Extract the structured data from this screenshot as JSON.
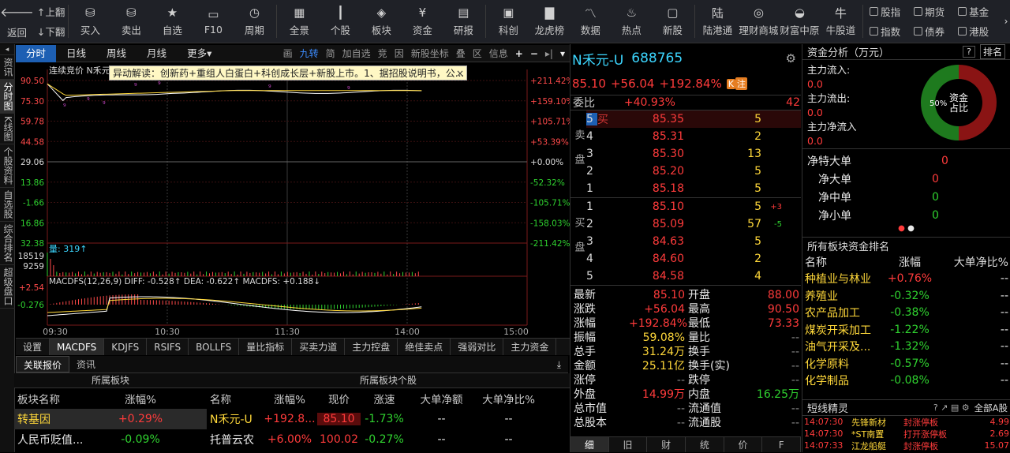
{
  "toolbar": {
    "back": "返回",
    "up": "上翻",
    "down": "下翻",
    "items": [
      {
        "label": "买入",
        "icon": "buy-icon"
      },
      {
        "label": "卖出",
        "icon": "sell-icon"
      },
      {
        "label": "自选",
        "icon": "star-icon"
      },
      {
        "label": "F10",
        "icon": "f10-icon"
      },
      {
        "label": "周期",
        "icon": "clock-icon"
      },
      {
        "label": "全景",
        "icon": "grid-icon"
      },
      {
        "label": "个股",
        "icon": "candle-icon"
      },
      {
        "label": "板块",
        "icon": "layers-icon"
      },
      {
        "label": "资金",
        "icon": "yen-icon"
      },
      {
        "label": "研报",
        "icon": "report-icon"
      },
      {
        "label": "科创",
        "icon": "chip-icon"
      },
      {
        "label": "龙虎榜",
        "icon": "bars-icon"
      },
      {
        "label": "数据",
        "icon": "linechart-icon"
      },
      {
        "label": "热点",
        "icon": "flame-icon"
      },
      {
        "label": "新股",
        "icon": "ipo-icon"
      },
      {
        "label": "陆港通",
        "icon": "lu-icon"
      },
      {
        "label": "理财商城",
        "icon": "target-icon"
      },
      {
        "label": "财富中原",
        "icon": "ingot-icon"
      },
      {
        "label": "牛股道",
        "icon": "bull-icon"
      }
    ],
    "exch": [
      "股指",
      "期货",
      "基金",
      "指数",
      "债券",
      "港股"
    ]
  },
  "leftbar": [
    "资讯",
    "分时图",
    "K线图",
    "个股资料",
    "自选股",
    "综合排名",
    "超级盘口"
  ],
  "period": {
    "tabs": [
      "分时",
      "日线",
      "周线",
      "月线",
      "更多▾"
    ],
    "tools": [
      "画",
      "九转",
      "简",
      "加自选",
      "竞",
      "因",
      "新股坐标",
      "叠",
      "区",
      "信息",
      "+",
      "−",
      "▸|",
      "▾"
    ]
  },
  "notice": {
    "text": "异动解读：创新药+重组人白蛋白+科创成长层+新股上市。1、据招股说明书，公...",
    "close": "×"
  },
  "chart": {
    "auction_label": "连续竞价",
    "name_short": "N禾元",
    "left_ticks": [
      "90.50",
      "75.30",
      "59.78",
      "44.58",
      "29.06",
      "13.86",
      "-1.66",
      "16.86",
      "32.38"
    ],
    "right_ticks": [
      "+211.42%",
      "+159.10%",
      "+105.71%",
      "+53.39%",
      "+0.00%",
      "-52.32%",
      "-105.71%",
      "-158.03%",
      "-211.42%"
    ],
    "vol_label": "量: 319↑",
    "vol_ticks": [
      "18519",
      "9259"
    ],
    "macd_label": "MACDFS(12,26,9) DIFF: -0.528↑ DEA: -0.622↑ MACDFS: +0.188↓",
    "macd_ticks": [
      "+2.54",
      "-0.276"
    ],
    "time_ticks": [
      "09:30",
      "10:30",
      "11:30",
      "14:00",
      "15:00"
    ]
  },
  "indicators": [
    "设置",
    "MACDFS",
    "KDJFS",
    "RSIFS",
    "BOLLFS",
    "量比指标",
    "买卖力道",
    "主力控盘",
    "绝佳卖点",
    "强弱对比",
    "主力资金"
  ],
  "subtabs": [
    "关联报价",
    "资讯"
  ],
  "blockpanel": {
    "title": "所属板块",
    "headers": [
      "板块名称",
      "涨幅%"
    ],
    "rows": [
      {
        "name": "转基因",
        "chg": "+0.29%"
      },
      {
        "name": "人民币贬值...",
        "chg": "-0.09%"
      }
    ]
  },
  "stockpanel": {
    "title": "所属板块个股",
    "headers": [
      "名称",
      "涨幅%",
      "现价",
      "涨速",
      "大单净额",
      "大单净比%"
    ],
    "rows": [
      {
        "name": "N禾元-U",
        "chg": "+192.8...",
        "price": "85.10",
        "speed": "-1.73%",
        "net": "--",
        "ratio": "--"
      },
      {
        "name": "托普云农",
        "chg": "+6.00%",
        "price": "100.02",
        "speed": "-0.27%",
        "net": "--",
        "ratio": "--"
      }
    ]
  },
  "quote": {
    "name": "N禾元-U",
    "code": "688765",
    "price": "85.10",
    "change": "+56.04",
    "pct": "+192.84%",
    "badges": [
      "K",
      "注"
    ],
    "webi_label": "委比",
    "webi": "+40.93%",
    "webi_diff": "42",
    "sell_label": "卖盘",
    "buy_label": "买盘",
    "asks": [
      {
        "lv": "5",
        "p": "85.35",
        "v": "5",
        "tag": "买"
      },
      {
        "lv": "4",
        "p": "85.31",
        "v": "2"
      },
      {
        "lv": "3",
        "p": "85.30",
        "v": "13"
      },
      {
        "lv": "2",
        "p": "85.20",
        "v": "5"
      },
      {
        "lv": "1",
        "p": "85.18",
        "v": "5"
      }
    ],
    "bids": [
      {
        "lv": "1",
        "p": "85.10",
        "v": "5",
        "d": "+3"
      },
      {
        "lv": "2",
        "p": "85.09",
        "v": "57",
        "d": "-5"
      },
      {
        "lv": "3",
        "p": "84.63",
        "v": "5"
      },
      {
        "lv": "4",
        "p": "84.60",
        "v": "2"
      },
      {
        "lv": "5",
        "p": "84.58",
        "v": "4"
      }
    ],
    "stats": [
      [
        "最新",
        "85.10",
        "开盘",
        "88.00"
      ],
      [
        "涨跌",
        "+56.04",
        "最高",
        "90.50"
      ],
      [
        "涨幅",
        "+192.84%",
        "最低",
        "73.33"
      ],
      [
        "振幅",
        "59.08%",
        "量比",
        "--"
      ],
      [
        "总手",
        "31.24万",
        "换手",
        "--"
      ],
      [
        "金额",
        "25.11亿",
        "换手(实)",
        "--"
      ],
      [
        "涨停",
        "--",
        "跌停",
        "--"
      ],
      [
        "外盘",
        "14.99万",
        "内盘",
        "16.25万"
      ],
      [
        "总市值",
        "--",
        "流通值",
        "--"
      ],
      [
        "总股本",
        "--",
        "流通股",
        "--"
      ]
    ],
    "bottom_tabs": [
      "细",
      "旧",
      "财",
      "统",
      "价",
      "F"
    ]
  },
  "fund": {
    "title": "资金分析（万元）",
    "help": "?",
    "rank": "排名",
    "flows": [
      {
        "label": "主力流入:",
        "val": "0.0"
      },
      {
        "label": "主力流出:",
        "val": "0.0"
      },
      {
        "label": "主力净流入",
        "val": "0.0"
      }
    ],
    "donut": {
      "center": "资金\n占比",
      "pct": "50%",
      "inflow": 0.5,
      "colors": [
        "#8a1414",
        "#1e7a1e"
      ]
    },
    "large": [
      {
        "label": "净特大单",
        "val": "0"
      },
      {
        "label": "净大单",
        "val": "0"
      },
      {
        "label": "净中单",
        "val": "0"
      },
      {
        "label": "净小单",
        "val": "0"
      }
    ],
    "sector_title": "所有板块资金排名",
    "sector_headers": [
      "名称",
      "涨幅",
      "大单净比%"
    ],
    "sectors": [
      {
        "name": "种植业与林业",
        "chg": "+0.76%",
        "r": "--"
      },
      {
        "name": "养殖业",
        "chg": "-0.32%",
        "r": "--"
      },
      {
        "name": "农产品加工",
        "chg": "-0.38%",
        "r": "--"
      },
      {
        "name": "煤炭开采加工",
        "chg": "-1.22%",
        "r": "--"
      },
      {
        "name": "油气开采及...",
        "chg": "-1.32%",
        "r": "--"
      },
      {
        "name": "化学原料",
        "chg": "-0.57%",
        "r": "--"
      },
      {
        "name": "化学制品",
        "chg": "-0.08%",
        "r": "--"
      }
    ],
    "short_title": "短线精灵",
    "short_filter": "全部A股",
    "short": [
      {
        "t": "14:07:30",
        "n": "先锋新材",
        "e": "封涨停板",
        "v": "4.99"
      },
      {
        "t": "14:07:30",
        "n": "*ST南置",
        "e": "打开涨停板",
        "v": "2.69"
      },
      {
        "t": "14:07:33",
        "n": "江龙船艇",
        "e": "封涨停板",
        "v": "15.07"
      }
    ]
  }
}
